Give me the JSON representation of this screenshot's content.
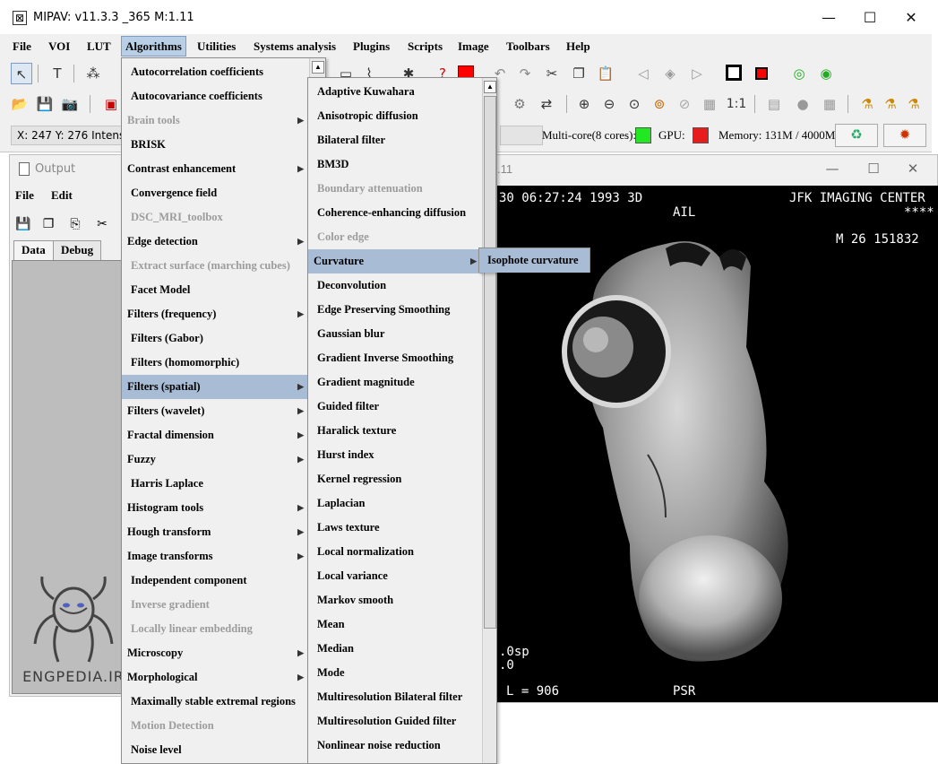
{
  "titlebar": {
    "title": "MIPAV:  v11.3.3    _365     M:1.11",
    "minimize": "—",
    "maximize": "☐",
    "close": "✕"
  },
  "menubar": [
    "File",
    "VOI",
    "LUT",
    "Algorithms",
    "Utilities",
    "Systems analysis",
    "Plugins",
    "Scripts",
    "Image",
    "Toolbars",
    "Help"
  ],
  "status": {
    "coords": "X: 247 Y: 276  Intensity",
    "multicore_label": "Multi-core(8 cores):",
    "gpu_label": "GPU:",
    "memory_label": "Memory: 131M / 4000M",
    "multicore_color": "#22e822",
    "gpu_color": "#e81c1c"
  },
  "output_window": {
    "title": "Output",
    "menu": [
      "File",
      "Edit"
    ],
    "tabs": [
      "Data",
      "Debug"
    ],
    "watermark": "ENGPEDIA.IR"
  },
  "image_window": {
    "title_suffix": ".11",
    "overlay": {
      "top_left": "30 06:27:24 1993 3D",
      "center_top": "AIL",
      "top_right": "JFK IMAGING CENTER",
      "stars": "****",
      "right_info": "M 26   151832",
      "bottom_left1": ".0sp",
      "bottom_left2": ".0",
      "level": "L = 906",
      "bottom_center": "PSR"
    }
  },
  "algorithms_menu": [
    {
      "label": "Autocorrelation coefficients",
      "enabled": true,
      "submenu": false
    },
    {
      "label": "Autocovariance coefficients",
      "enabled": true,
      "submenu": false
    },
    {
      "label": "Brain tools",
      "enabled": false,
      "submenu": true
    },
    {
      "label": "BRISK",
      "enabled": true,
      "submenu": false
    },
    {
      "label": "Contrast enhancement",
      "enabled": true,
      "submenu": true
    },
    {
      "label": "Convergence field",
      "enabled": true,
      "submenu": false
    },
    {
      "label": "DSC_MRI_toolbox",
      "enabled": false,
      "submenu": false
    },
    {
      "label": "Edge detection",
      "enabled": true,
      "submenu": true
    },
    {
      "label": "Extract surface (marching cubes)",
      "enabled": false,
      "submenu": false
    },
    {
      "label": "Facet Model",
      "enabled": true,
      "submenu": false
    },
    {
      "label": "Filters (frequency)",
      "enabled": true,
      "submenu": true
    },
    {
      "label": "Filters (Gabor)",
      "enabled": true,
      "submenu": false
    },
    {
      "label": "Filters (homomorphic)",
      "enabled": true,
      "submenu": false
    },
    {
      "label": "Filters (spatial)",
      "enabled": true,
      "submenu": true,
      "highlighted": true
    },
    {
      "label": "Filters (wavelet)",
      "enabled": true,
      "submenu": true
    },
    {
      "label": "Fractal dimension",
      "enabled": true,
      "submenu": true
    },
    {
      "label": "Fuzzy",
      "enabled": true,
      "submenu": true
    },
    {
      "label": "Harris Laplace",
      "enabled": true,
      "submenu": false
    },
    {
      "label": "Histogram tools",
      "enabled": true,
      "submenu": true
    },
    {
      "label": "Hough transform",
      "enabled": true,
      "submenu": true
    },
    {
      "label": "Image transforms",
      "enabled": true,
      "submenu": true
    },
    {
      "label": "Independent component",
      "enabled": true,
      "submenu": false
    },
    {
      "label": "Inverse gradient",
      "enabled": false,
      "submenu": false
    },
    {
      "label": "Locally linear embedding",
      "enabled": false,
      "submenu": false
    },
    {
      "label": "Microscopy",
      "enabled": true,
      "submenu": true
    },
    {
      "label": "Morphological",
      "enabled": true,
      "submenu": true
    },
    {
      "label": "Maximally stable extremal regions",
      "enabled": true,
      "submenu": false
    },
    {
      "label": "Motion Detection",
      "enabled": false,
      "submenu": false
    },
    {
      "label": "Noise level",
      "enabled": true,
      "submenu": false
    }
  ],
  "spatial_menu": [
    {
      "label": "Adaptive Kuwahara",
      "enabled": true
    },
    {
      "label": "Anisotropic diffusion",
      "enabled": true
    },
    {
      "label": "Bilateral filter",
      "enabled": true
    },
    {
      "label": "BM3D",
      "enabled": true
    },
    {
      "label": "Boundary attenuation",
      "enabled": false
    },
    {
      "label": "Coherence-enhancing diffusion",
      "enabled": true
    },
    {
      "label": "Color edge",
      "enabled": false
    },
    {
      "label": "Curvature",
      "enabled": true,
      "submenu": true,
      "highlighted": true
    },
    {
      "label": "Deconvolution",
      "enabled": true
    },
    {
      "label": "Edge Preserving Smoothing",
      "enabled": true
    },
    {
      "label": "Gaussian blur",
      "enabled": true
    },
    {
      "label": "Gradient Inverse Smoothing",
      "enabled": true
    },
    {
      "label": "Gradient magnitude",
      "enabled": true
    },
    {
      "label": "Guided filter",
      "enabled": true
    },
    {
      "label": "Haralick texture",
      "enabled": true
    },
    {
      "label": "Hurst index",
      "enabled": true
    },
    {
      "label": "Kernel regression",
      "enabled": true
    },
    {
      "label": "Laplacian",
      "enabled": true
    },
    {
      "label": "Laws texture",
      "enabled": true
    },
    {
      "label": "Local normalization",
      "enabled": true
    },
    {
      "label": "Local variance",
      "enabled": true
    },
    {
      "label": "Markov smooth",
      "enabled": true
    },
    {
      "label": "Mean",
      "enabled": true
    },
    {
      "label": "Median",
      "enabled": true
    },
    {
      "label": "Mode",
      "enabled": true
    },
    {
      "label": "Multiresolution Bilateral filter",
      "enabled": true
    },
    {
      "label": "Multiresolution Guided filter",
      "enabled": true
    },
    {
      "label": "Nonlinear noise reduction",
      "enabled": true
    }
  ],
  "curvature_menu": [
    {
      "label": "Isophote curvature",
      "highlighted": true
    }
  ],
  "toolbar1_icons": [
    "pointer-icon",
    "text-icon",
    "points-icon",
    "undo-icon",
    "redo-icon",
    "cut-icon",
    "copy-icon",
    "paste-icon",
    "color-icon",
    "help-icon"
  ],
  "toolbar1_text": {
    "text_tool": "T"
  },
  "toolbar2_text": {
    "one_to_one": "1:1"
  }
}
